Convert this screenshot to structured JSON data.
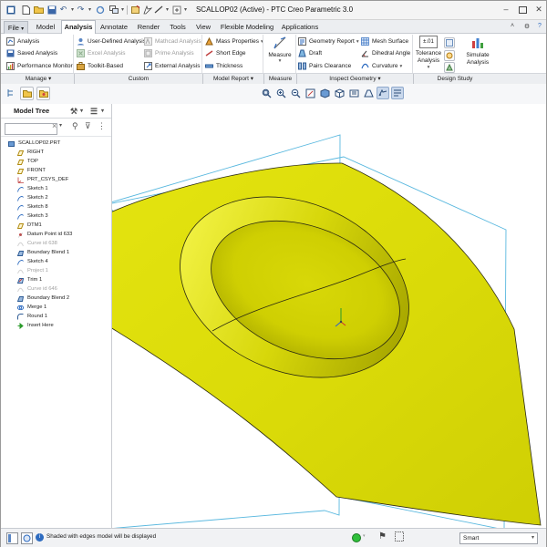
{
  "title": "SCALLOP02 (Active) - PTC Creo Parametric 3.0",
  "menu_tabs": [
    {
      "label": "File",
      "arrow": "▾"
    },
    {
      "label": "Model"
    },
    {
      "label": "Analysis"
    },
    {
      "label": "Annotate"
    },
    {
      "label": "Render"
    },
    {
      "label": "Tools"
    },
    {
      "label": "View"
    },
    {
      "label": "Flexible Modeling"
    },
    {
      "label": "Applications"
    }
  ],
  "ribbon": {
    "manage": {
      "analysis": "Analysis",
      "saved_analysis": "Saved Analysis",
      "performance_monitor": "Performance Monitor"
    },
    "custom": {
      "user_defined": "User-Defined Analysis",
      "excel": "Excel Analysis",
      "toolkit": "Toolkit-Based",
      "matchcad": "Mathcad Analysis",
      "prime": "Prime Analysis",
      "external": "External Analysis"
    },
    "model_report": {
      "mass_properties": "Mass Properties",
      "short_edge": "Short Edge",
      "thickness": "Thickness"
    },
    "measure": {
      "label": "Measure"
    },
    "inspect": {
      "geometry_report": "Geometry Report",
      "draft": "Draft",
      "pairs_clearance": "Pairs Clearance",
      "mesh_surface": "Mesh Surface",
      "dihedral_angle": "Dihedral Angle",
      "curvature": "Curvature"
    },
    "design_study": {
      "tolerance_analysis": "Tolerance Analysis",
      "tolerance_value": "±.01",
      "simulate_analysis": "Simulate Analysis"
    }
  },
  "groups": [
    "Manage",
    "Custom",
    "Model Report",
    "Measure",
    "Inspect Geometry",
    "Design Study"
  ],
  "group_arrow": "▾",
  "model_tree": {
    "title": "Model Tree",
    "items": [
      {
        "label": "SCALLOP02.PRT",
        "icon": "part-icon",
        "dim": false
      },
      {
        "label": "RIGHT",
        "icon": "datum-plane-icon",
        "dim": false
      },
      {
        "label": "TOP",
        "icon": "datum-plane-icon",
        "dim": false
      },
      {
        "label": "FRONT",
        "icon": "datum-plane-icon",
        "dim": false
      },
      {
        "label": "PRT_CSYS_DEF",
        "icon": "csys-icon",
        "dim": false
      },
      {
        "label": "Sketch 1",
        "icon": "sketch-icon",
        "dim": false
      },
      {
        "label": "Sketch 2",
        "icon": "sketch-icon",
        "dim": false
      },
      {
        "label": "Sketch 8",
        "icon": "sketch-icon",
        "dim": false
      },
      {
        "label": "Sketch 3",
        "icon": "sketch-icon",
        "dim": false
      },
      {
        "label": "DTM1",
        "icon": "datum-plane-icon",
        "dim": false
      },
      {
        "label": "Datum Point id 633",
        "icon": "datum-point-icon",
        "dim": false
      },
      {
        "label": "Curve id 638",
        "icon": "curve-icon",
        "dim": true
      },
      {
        "label": "Boundary Blend 1",
        "icon": "blend-icon",
        "dim": false
      },
      {
        "label": "Sketch 4",
        "icon": "sketch-icon",
        "dim": false
      },
      {
        "label": "Project 1",
        "icon": "curve-icon",
        "dim": true
      },
      {
        "label": "Trim 1",
        "icon": "trim-icon",
        "dim": false
      },
      {
        "label": "Curve id 646",
        "icon": "curve-icon",
        "dim": true
      },
      {
        "label": "Boundary Blend 2",
        "icon": "blend-icon",
        "dim": false
      },
      {
        "label": "Merge 1",
        "icon": "merge-icon",
        "dim": false
      },
      {
        "label": "Round 1",
        "icon": "round-icon",
        "dim": false
      },
      {
        "label": "Insert Here",
        "icon": "insert-arrow-icon",
        "dim": false
      }
    ]
  },
  "status": {
    "message": "Shaded with edges model will be displayed",
    "filter_value": "Smart",
    "dropdown_arrow": "▾"
  },
  "colors": {
    "surface": "#e0e010",
    "surface_shadow": "#b8b800",
    "edge": "#2a2a12",
    "datum": "#59b8df",
    "active_tab": "#ffffff"
  }
}
